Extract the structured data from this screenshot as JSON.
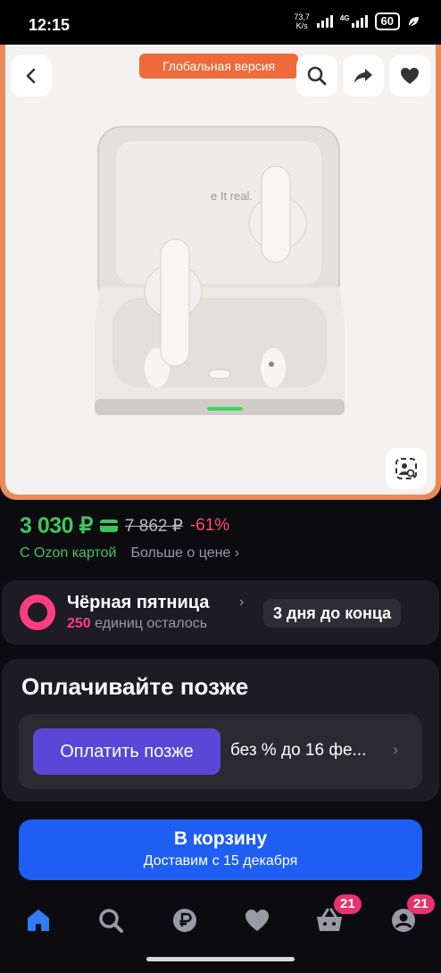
{
  "status_bar": {
    "time": "12:15",
    "net_speed_value": "73,7",
    "net_speed_unit": "K/s",
    "network": "4G",
    "battery": "60"
  },
  "product_image": {
    "badge": "Глобальная версия",
    "case_print": "e It real.",
    "icons": [
      "back-icon",
      "search-icon",
      "share-icon",
      "heart-icon",
      "image-search-icon"
    ]
  },
  "price": {
    "current": "3 030 ₽",
    "old": "7 862 ₽",
    "discount": "-61%",
    "ozon_card": "С Ozon картой",
    "more": "Больше о цене ›"
  },
  "black_friday": {
    "title": "Чёрная пятница",
    "chevron": "›",
    "units_count": "250",
    "units_text": "единиц осталось",
    "days_left": "3 дня до конца"
  },
  "pay_later": {
    "title": "Оплачивайте позже",
    "button": "Оплатить позже",
    "terms": "без % до 16 фе...",
    "chevron": "›"
  },
  "cart": {
    "title": "В корзину",
    "delivery": "Доставим с 15 декабря"
  },
  "bottom_nav": {
    "items": [
      "home-icon",
      "search-icon",
      "ruble-icon",
      "heart-icon",
      "basket-icon",
      "profile-icon"
    ],
    "cart_badge": "21",
    "profile_badge": "21"
  },
  "colors": {
    "price_green": "#3ec55f",
    "discount_red": "#ff4d6d",
    "friday_pink": "#ff3d7f",
    "pay_purple": "#5a47d8",
    "cart_blue": "#1e5ef3",
    "badge_orange": "#ef6a3a",
    "active_nav": "#2f7cf6"
  }
}
